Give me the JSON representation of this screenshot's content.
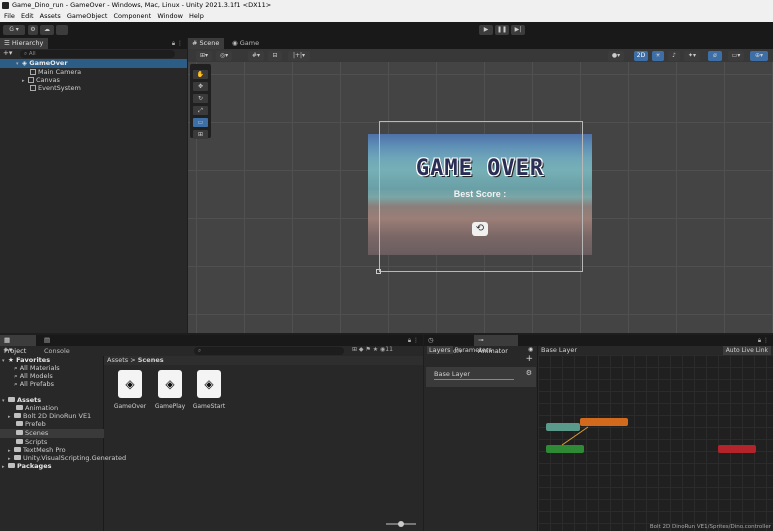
{
  "window": {
    "title": "Game_Dino_run - GameOver - Windows, Mac, Linux - Unity 2021.3.1f1 <DX11>"
  },
  "menu": [
    "File",
    "Edit",
    "Assets",
    "GameObject",
    "Component",
    "Window",
    "Help"
  ],
  "toolbar": {
    "account": "G",
    "play": "▶",
    "pause": "❚❚",
    "step": "▶|"
  },
  "hierarchy": {
    "tab": "Hierarchy",
    "search_placeholder": "All",
    "scene": "GameOver",
    "items": [
      "Main Camera",
      "Canvas",
      "EventSystem"
    ]
  },
  "scene_view": {
    "tabs": [
      "Scene",
      "Game"
    ],
    "mode_2d": "2D",
    "game_over_text": "GAME OVER",
    "best_score_text": "Best Score :",
    "restart_icon": "⟲"
  },
  "project": {
    "tabs": [
      "Project",
      "Console"
    ],
    "count": "11",
    "favorites_header": "Favorites",
    "favorites": [
      "All Materials",
      "All Models",
      "All Prefabs"
    ],
    "assets_header": "Assets",
    "folders": [
      "Animation",
      "Bolt 2D DinoRun VE1",
      "Prefeb",
      "Scenes",
      "Scripts",
      "TextMesh Pro",
      "Unity.VisualScripting.Generated"
    ],
    "packages": "Packages",
    "breadcrumb": [
      "Assets",
      "Scenes"
    ],
    "scene_files": [
      "GameOver",
      "GamePlay",
      "GameStart"
    ]
  },
  "animator": {
    "tabs": [
      "Animation",
      "Animator"
    ],
    "subtabs": [
      "Layers",
      "Parameters"
    ],
    "layer": "Base Layer",
    "breadcrumb": "Base Layer",
    "live_link": "Auto Live Link",
    "status": "Bolt 2D DinoRun VE1/Sprites/Dino.controller"
  }
}
